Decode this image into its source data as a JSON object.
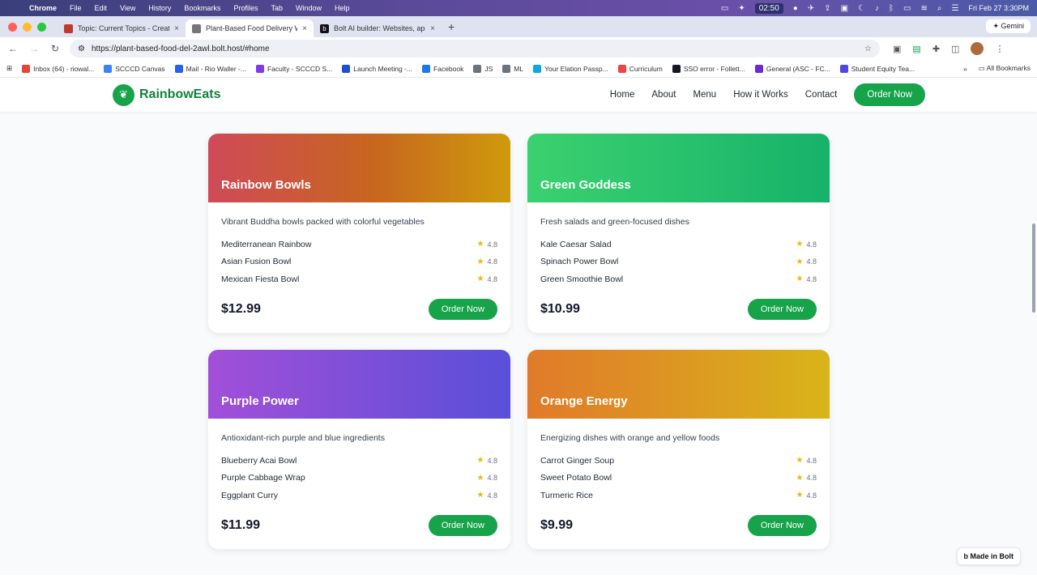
{
  "menubar": {
    "app": "Chrome",
    "items": [
      "File",
      "Edit",
      "View",
      "History",
      "Bookmarks",
      "Profiles",
      "Tab",
      "Window",
      "Help"
    ],
    "timer": "02:50",
    "datetime": "Fri Feb 27  3:30PM"
  },
  "tabs": [
    {
      "label": "Topic: Current Topics - Creat",
      "color": "#c0392b"
    },
    {
      "label": "Plant-Based Food Delivery W",
      "color": "#777777"
    },
    {
      "label": "Bolt AI builder: Websites, app",
      "color": "#111111"
    }
  ],
  "gemini_label": "Gemini",
  "address": {
    "url": "https://plant-based-food-del-2awl.bolt.host/#home"
  },
  "bookmarks": {
    "items": [
      {
        "label": "Inbox (64) - riowal...",
        "color": "#ea4335"
      },
      {
        "label": "SCCCD Canvas",
        "color": "#3b82f6"
      },
      {
        "label": "Mail - Rio Waller -...",
        "color": "#2563eb"
      },
      {
        "label": "Faculty - SCCCD S...",
        "color": "#7c3aed"
      },
      {
        "label": "Launch Meeting -...",
        "color": "#1d4ed8"
      },
      {
        "label": "Facebook",
        "color": "#1877f2"
      },
      {
        "label": "JS",
        "color": "#6b7280"
      },
      {
        "label": "ML",
        "color": "#6b7280"
      },
      {
        "label": "Your Elation Passp...",
        "color": "#0ea5e9"
      },
      {
        "label": "Curriculum",
        "color": "#ef4444"
      },
      {
        "label": "SSO error - Follett...",
        "color": "#111827"
      },
      {
        "label": "General (ASC - FC...",
        "color": "#6d28d9"
      },
      {
        "label": "Student Equity Tea...",
        "color": "#4f46e5"
      }
    ],
    "all_label": "All Bookmarks"
  },
  "site": {
    "brand": "RainbowEats",
    "nav": [
      "Home",
      "About",
      "Menu",
      "How it Works",
      "Contact"
    ],
    "cta": "Order Now",
    "cards": [
      {
        "title": "Rainbow Bowls",
        "desc": "Vibrant Buddha bowls packed with colorful vegetables",
        "items": [
          {
            "name": "Mediterranean Rainbow",
            "rating": "4.8"
          },
          {
            "name": "Asian Fusion Bowl",
            "rating": "4.8"
          },
          {
            "name": "Mexican Fiesta Bowl",
            "rating": "4.8"
          }
        ],
        "price": "$12.99",
        "button": "Order Now"
      },
      {
        "title": "Green Goddess",
        "desc": "Fresh salads and green-focused dishes",
        "items": [
          {
            "name": "Kale Caesar Salad",
            "rating": "4.8"
          },
          {
            "name": "Spinach Power Bowl",
            "rating": "4.8"
          },
          {
            "name": "Green Smoothie Bowl",
            "rating": "4.8"
          }
        ],
        "price": "$10.99",
        "button": "Order Now"
      },
      {
        "title": "Purple Power",
        "desc": "Antioxidant-rich purple and blue ingredients",
        "items": [
          {
            "name": "Blueberry Acai Bowl",
            "rating": "4.8"
          },
          {
            "name": "Purple Cabbage Wrap",
            "rating": "4.8"
          },
          {
            "name": "Eggplant Curry",
            "rating": "4.8"
          }
        ],
        "price": "$11.99",
        "button": "Order Now"
      },
      {
        "title": "Orange Energy",
        "desc": "Energizing dishes with orange and yellow foods",
        "items": [
          {
            "name": "Carrot Ginger Soup",
            "rating": "4.8"
          },
          {
            "name": "Sweet Potato Bowl",
            "rating": "4.8"
          },
          {
            "name": "Turmeric Rice",
            "rating": "4.8"
          }
        ],
        "price": "$9.99",
        "button": "Order Now"
      }
    ],
    "made_in_bolt": "Made in Bolt"
  }
}
